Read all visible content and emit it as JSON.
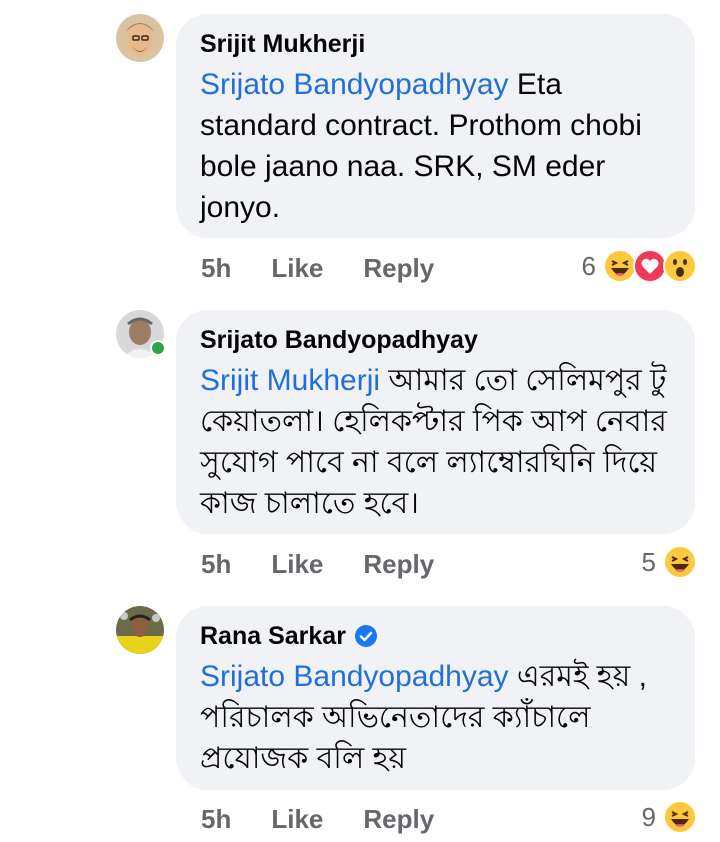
{
  "comments": [
    {
      "author": "Srijit Mukherji",
      "mention": "Srijato Bandyopadhyay",
      "text": " Eta standard contract. Prothom chobi bole jaano naa. SRK, SM eder jonyo.",
      "time": "5h",
      "like": "Like",
      "reply": "Reply",
      "reaction_count": "6",
      "reactions": [
        "haha-icon",
        "love-icon",
        "wow-icon"
      ]
    },
    {
      "author": "Srijato Bandyopadhyay",
      "mention": "Srijit Mukherji",
      "text": " আমার তো সেলিমপুর টু কেয়াতলা। হেলিকপ্টার পিক আপ নেবার সুযোগ পাবে না বলে ল্যাম্বোরঘিনি দিয়ে কাজ চালাতে হবে।",
      "time": "5h",
      "like": "Like",
      "reply": "Reply",
      "reaction_count": "5",
      "reactions": [
        "haha-icon"
      ],
      "online": true
    },
    {
      "author": "Rana Sarkar",
      "verified": true,
      "mention": "Srijato Bandyopadhyay",
      "text": " এরমই হয় , পরিচালক অভিনেতাদের ক্যাঁচালে প্রযোজক বলি হয়",
      "time": "5h",
      "like": "Like",
      "reply": "Reply",
      "reaction_count": "9",
      "reactions": [
        "haha-icon"
      ]
    }
  ],
  "colors": {
    "mention": "#216fdb",
    "bubble": "#f0f2f5",
    "meta": "#65676b",
    "verified": "#1877f2",
    "online": "#31a24c"
  }
}
